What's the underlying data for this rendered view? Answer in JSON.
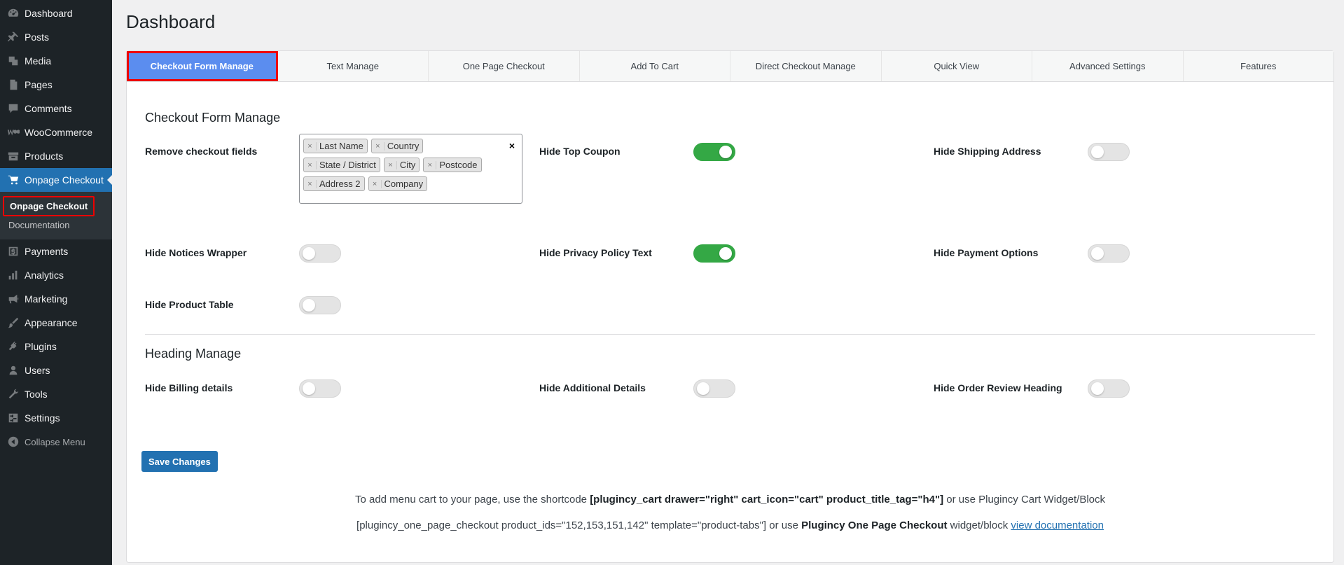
{
  "sidebar": {
    "items": [
      {
        "label": "Dashboard",
        "icon": "dashboard-icon"
      },
      {
        "label": "Posts",
        "icon": "pin-icon"
      },
      {
        "label": "Media",
        "icon": "media-icon"
      },
      {
        "label": "Pages",
        "icon": "pages-icon"
      },
      {
        "label": "Comments",
        "icon": "comment-icon"
      },
      {
        "label": "WooCommerce",
        "icon": "woocommerce-icon"
      },
      {
        "label": "Products",
        "icon": "archive-icon"
      },
      {
        "label": "Onpage Checkout",
        "icon": "cart-icon"
      }
    ],
    "submenu": [
      "Onpage Checkout",
      "Documentation"
    ],
    "items_after": [
      {
        "label": "Payments",
        "icon": "dollar-icon"
      },
      {
        "label": "Analytics",
        "icon": "chart-bar-icon"
      },
      {
        "label": "Marketing",
        "icon": "megaphone-icon"
      },
      {
        "label": "Appearance",
        "icon": "paintbrush-icon"
      },
      {
        "label": "Plugins",
        "icon": "plug-icon"
      },
      {
        "label": "Users",
        "icon": "user-icon"
      },
      {
        "label": "Tools",
        "icon": "wrench-icon"
      },
      {
        "label": "Settings",
        "icon": "settings-icon"
      }
    ],
    "collapse": "Collapse Menu"
  },
  "page_title": "Dashboard",
  "tabs": [
    "Checkout Form Manage",
    "Text Manage",
    "One Page Checkout",
    "Add To Cart",
    "Direct Checkout Manage",
    "Quick View",
    "Advanced Settings",
    "Features"
  ],
  "checkout_section": {
    "title": "Checkout Form Manage",
    "remove_fields_label": "Remove checkout fields",
    "removed_fields": [
      "Last Name",
      "Country",
      "State / District",
      "City",
      "Postcode",
      "Address 2",
      "Company"
    ],
    "clear_symbol": "×",
    "chip_remove_symbol": "×",
    "toggles": [
      {
        "label": "Hide Top Coupon",
        "on": true
      },
      {
        "label": "Hide Shipping Address",
        "on": false
      },
      {
        "label": "Hide Notices Wrapper",
        "on": false
      },
      {
        "label": "Hide Privacy Policy Text",
        "on": true
      },
      {
        "label": "Hide Payment Options",
        "on": false
      },
      {
        "label": "Hide Product Table",
        "on": false
      }
    ]
  },
  "heading_section": {
    "title": "Heading Manage",
    "toggles": [
      {
        "label": "Hide Billing details",
        "on": false
      },
      {
        "label": "Hide Additional Details",
        "on": false
      },
      {
        "label": "Hide Order Review Heading",
        "on": false
      }
    ]
  },
  "save_label": "Save Changes",
  "notes": {
    "line1_pre": "To add menu cart to your page, use the shortcode ",
    "line1_code": "[plugincy_cart drawer=\"right\" cart_icon=\"cart\" product_title_tag=\"h4\"]",
    "line1_post": " or use Plugincy Cart Widget/Block",
    "line2_pre": "[plugincy_one_page_checkout product_ids=\"152,153,151,142\" template=\"product-tabs\"] or use ",
    "line2_bold": "Plugincy One Page Checkout",
    "line2_mid": " widget/block ",
    "line2_link": "view documentation"
  },
  "colors": {
    "sidebar_bg": "#1d2327",
    "active_menu": "#2271b1",
    "active_tab": "#5b8def",
    "toggle_on": "#34a845",
    "highlight_border": "#ee0000"
  }
}
